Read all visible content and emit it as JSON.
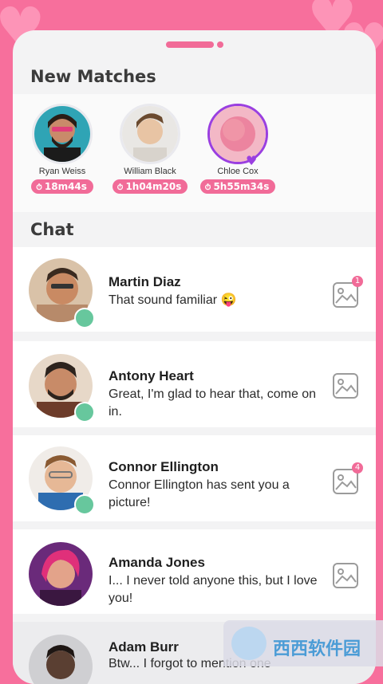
{
  "header": {
    "new_matches_title": "New Matches",
    "chat_title": "Chat"
  },
  "matches": [
    {
      "name": "Ryan Weiss",
      "timer": "18m44s"
    },
    {
      "name": "William Black",
      "timer": "1h04m20s"
    },
    {
      "name": "Chloe Cox",
      "timer": "5h55m34s"
    }
  ],
  "chats": [
    {
      "name": "Martin Diaz",
      "message": "That sound familiar 😜",
      "badge": "1"
    },
    {
      "name": "Antony Heart",
      "message": "Great, I'm glad to hear that, come on in.",
      "badge": ""
    },
    {
      "name": "Connor Ellington",
      "message": "Connor Ellington has sent you a picture!",
      "badge": "4"
    },
    {
      "name": "Amanda Jones",
      "message": "I... I never told anyone this, but I love you!",
      "badge": ""
    },
    {
      "name": "Adam Burr",
      "message": "Btw... I forgot to mention one",
      "badge": ""
    }
  ],
  "watermark": {
    "text": "西西软件园"
  },
  "colors": {
    "background": "#f76f9c",
    "accent": "#f16b98",
    "online": "#67c79d",
    "highlight": "#9a3fe0"
  }
}
